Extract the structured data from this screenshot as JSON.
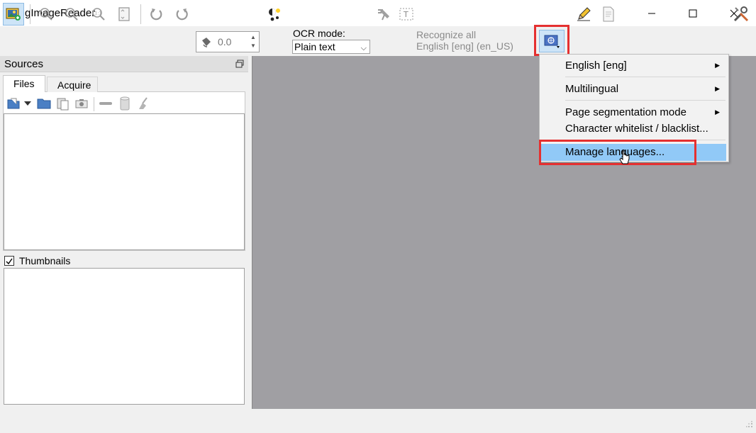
{
  "window": {
    "title": "gImageReader",
    "icon": "scanner-document-icon",
    "controls": [
      "minimize-icon",
      "maximize-icon",
      "close-icon"
    ]
  },
  "toolbar": {
    "rotation_value": "0.0",
    "ocr_mode_label": "OCR mode:",
    "ocr_mode_value": "Plain text",
    "recognize_line1": "Recognize all",
    "recognize_line2": "English [eng] (en_US)"
  },
  "sources": {
    "title": "Sources",
    "tabs": [
      {
        "label": "Files",
        "active": true
      },
      {
        "label": "Acquire",
        "active": false
      }
    ],
    "thumbnails_label": "Thumbnails",
    "thumbnails_checked": true
  },
  "language_menu": {
    "items": [
      {
        "label": "English [eng]",
        "submenu": true
      },
      {
        "label": "Multilingual",
        "submenu": true
      },
      {
        "label": "Page segmentation mode",
        "submenu": true
      },
      {
        "label": "Character whitelist / blacklist...",
        "submenu": false
      },
      {
        "label": "Manage languages...",
        "submenu": false,
        "highlighted": true
      }
    ]
  },
  "colors": {
    "canvas": "#a09fa3",
    "highlight": "#91c9f7",
    "annotation_red": "#e53030"
  }
}
